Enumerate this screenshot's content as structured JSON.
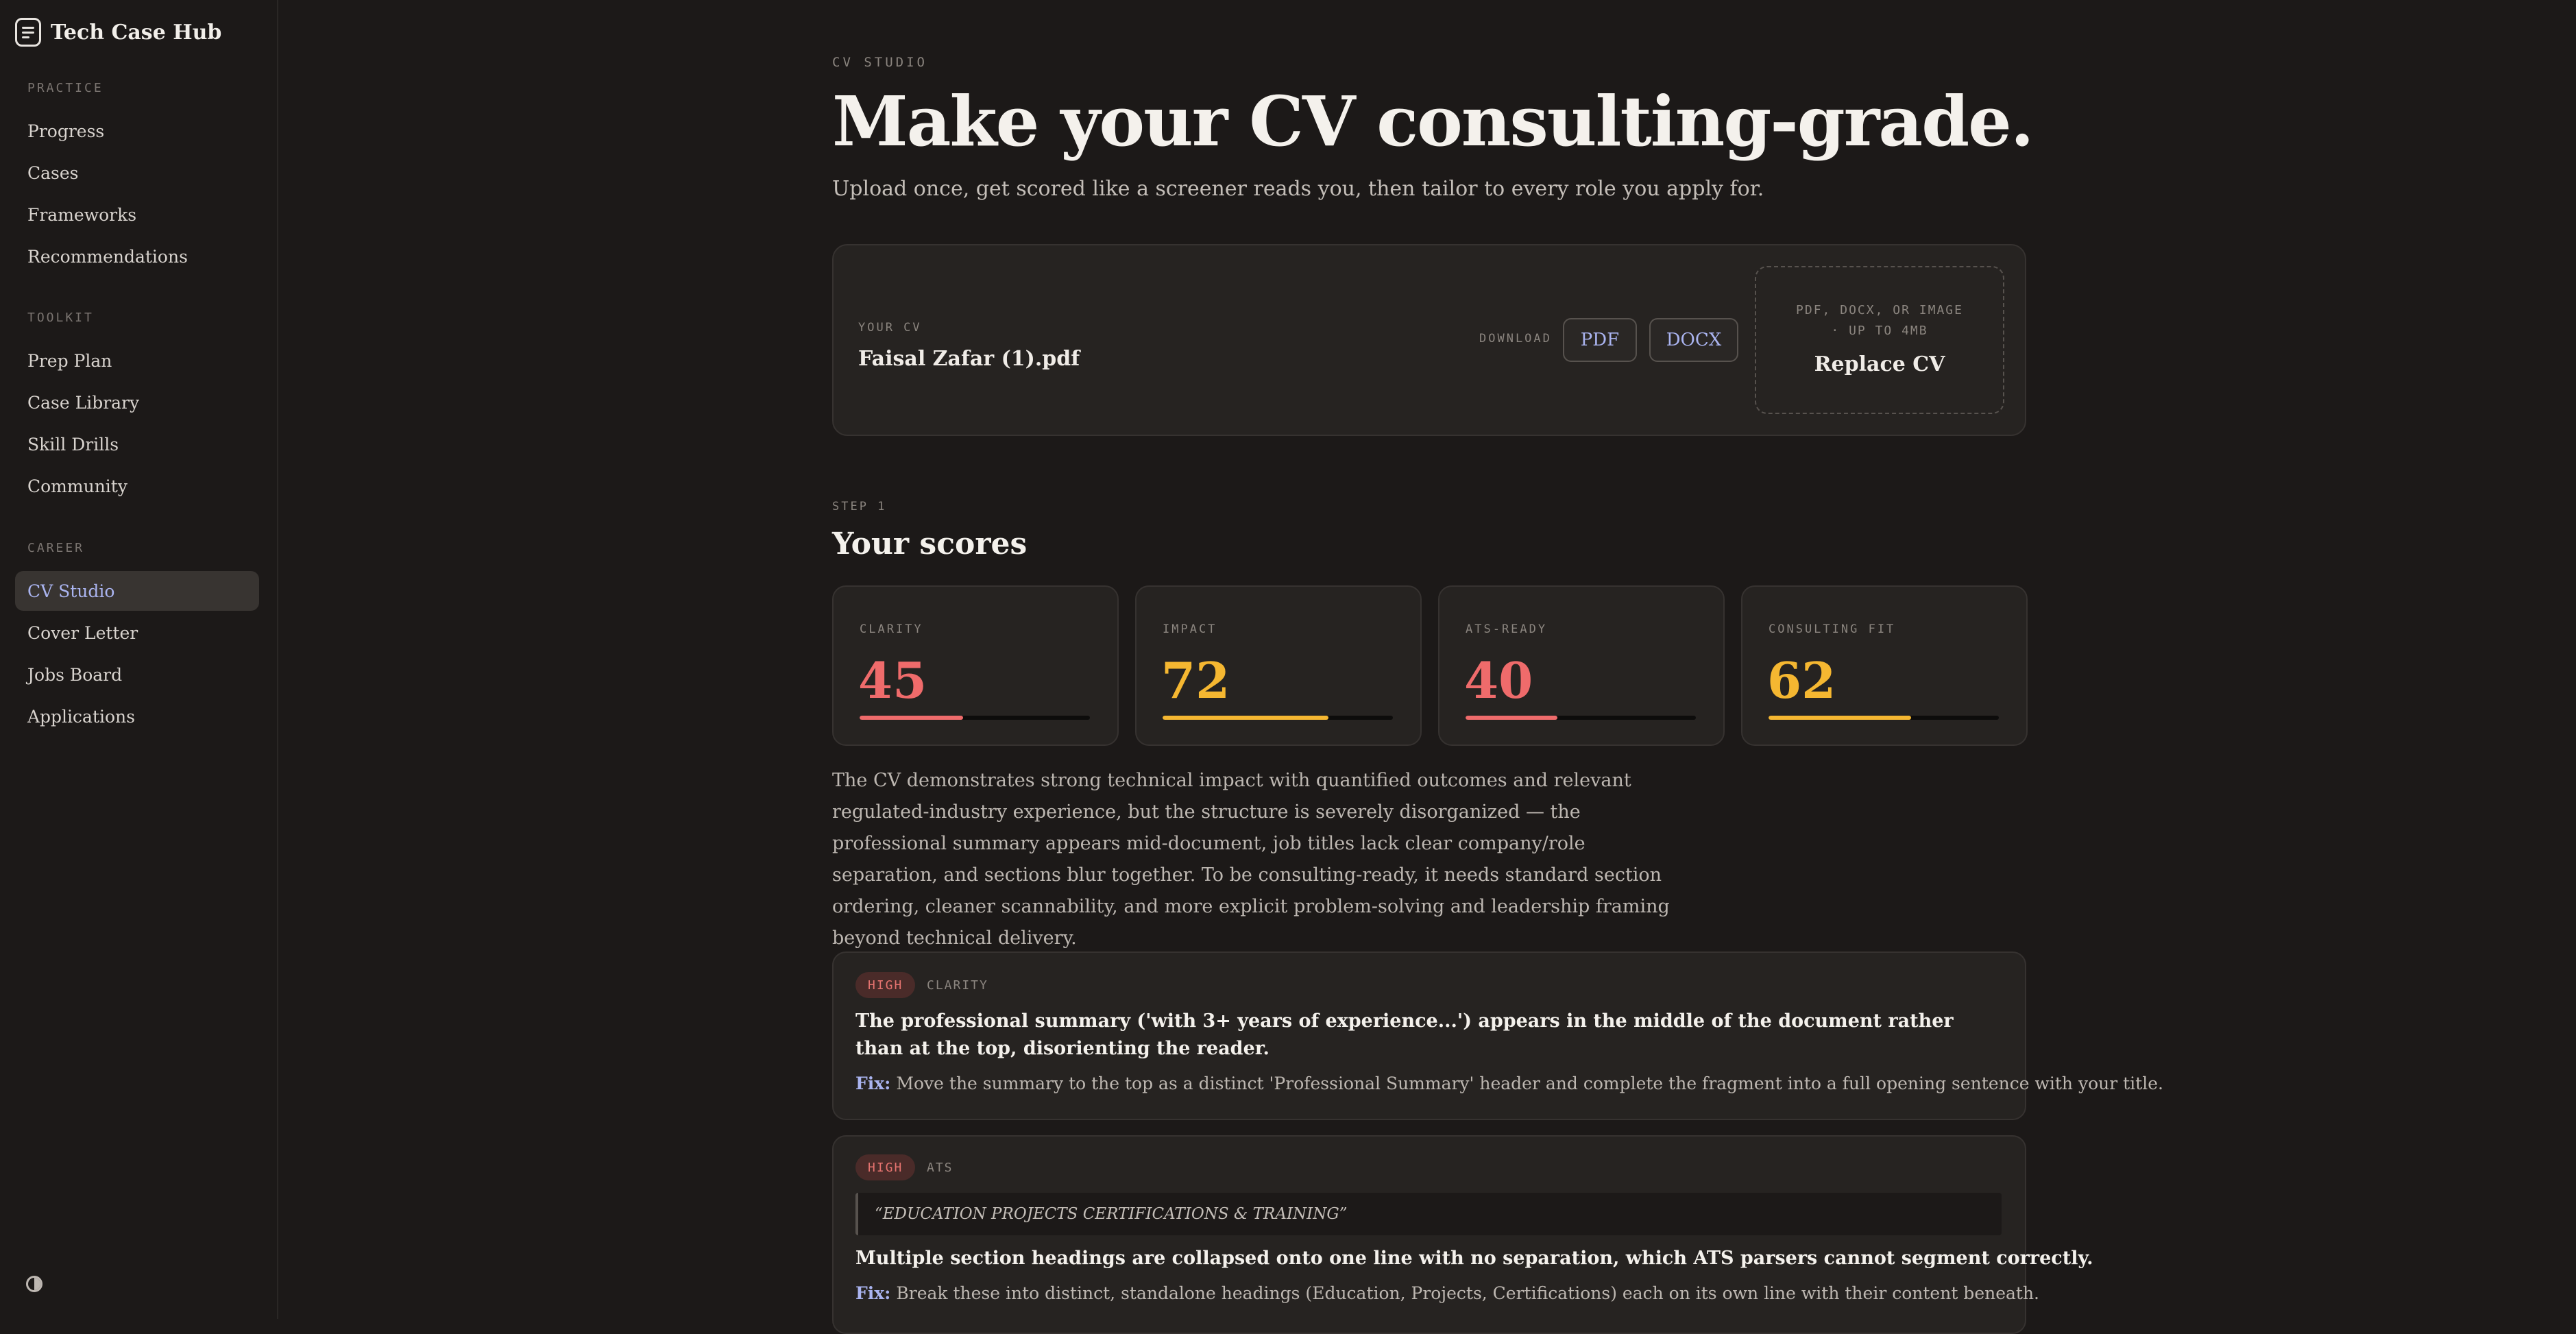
{
  "app": {
    "title": "Tech Case Hub"
  },
  "sidebar": {
    "sections": [
      {
        "label": "PRACTICE",
        "items": [
          "Progress",
          "Cases",
          "Frameworks",
          "Recommendations"
        ]
      },
      {
        "label": "TOOLKIT",
        "items": [
          "Prep Plan",
          "Case Library",
          "Skill Drills",
          "Community"
        ]
      },
      {
        "label": "CAREER",
        "items": [
          "CV Studio",
          "Cover Letter",
          "Jobs Board",
          "Applications"
        ]
      }
    ],
    "active_item": "CV Studio"
  },
  "header": {
    "eyebrow": "CV STUDIO",
    "title": "Make your CV consulting-grade.",
    "subtitle": "Upload once, get scored like a screener reads you, then tailor to every role you apply for."
  },
  "cv": {
    "label": "YOUR CV",
    "filename": "Faisal Zafar (1).pdf",
    "download_label": "DOWNLOAD",
    "pdf_label": "PDF",
    "docx_label": "DOCX",
    "upload_hint_line1": "PDF, DOCX, OR IMAGE",
    "upload_hint_line2": "· UP TO 4MB",
    "replace_label": "Replace CV"
  },
  "scores": {
    "step": "STEP 1",
    "title": "Your scores",
    "items": [
      {
        "label": "CLARITY",
        "value": "45",
        "percent": 45,
        "color": "#ef6b6b"
      },
      {
        "label": "IMPACT",
        "value": "72",
        "percent": 72,
        "color": "#f5b731"
      },
      {
        "label": "ATS-READY",
        "value": "40",
        "percent": 40,
        "color": "#ef6b6b"
      },
      {
        "label": "CONSULTING FIT",
        "value": "62",
        "percent": 62,
        "color": "#f5b731"
      }
    ],
    "summary": "The CV demonstrates strong technical impact with quantified outcomes and relevant regulated-industry experience, but the structure is severely disorganized — the professional summary appears mid-document, job titles lack clear company/role separation, and sections blur together. To be consulting-ready, it needs standard section ordering, cleaner scannability, and more explicit problem-solving and leadership framing beyond technical delivery."
  },
  "issues": [
    {
      "severity": "HIGH",
      "category": "CLARITY",
      "title": "The professional summary ('with 3+ years of experience...') appears in the middle of the document rather than at the top, disorienting the reader.",
      "fix_label": "Fix:",
      "fix": "Move the summary to the top as a distinct 'Professional Summary' header and complete the fragment into a full opening sentence with your title."
    },
    {
      "severity": "HIGH",
      "category": "ATS",
      "quote": "“EDUCATION PROJECTS CERTIFICATIONS & TRAINING”",
      "title": "Multiple section headings are collapsed onto one line with no separation, which ATS parsers cannot segment correctly.",
      "fix_label": "Fix:",
      "fix": "Break these into distinct, standalone headings (Education, Projects, Certifications) each on its own line with their content beneath."
    }
  ]
}
